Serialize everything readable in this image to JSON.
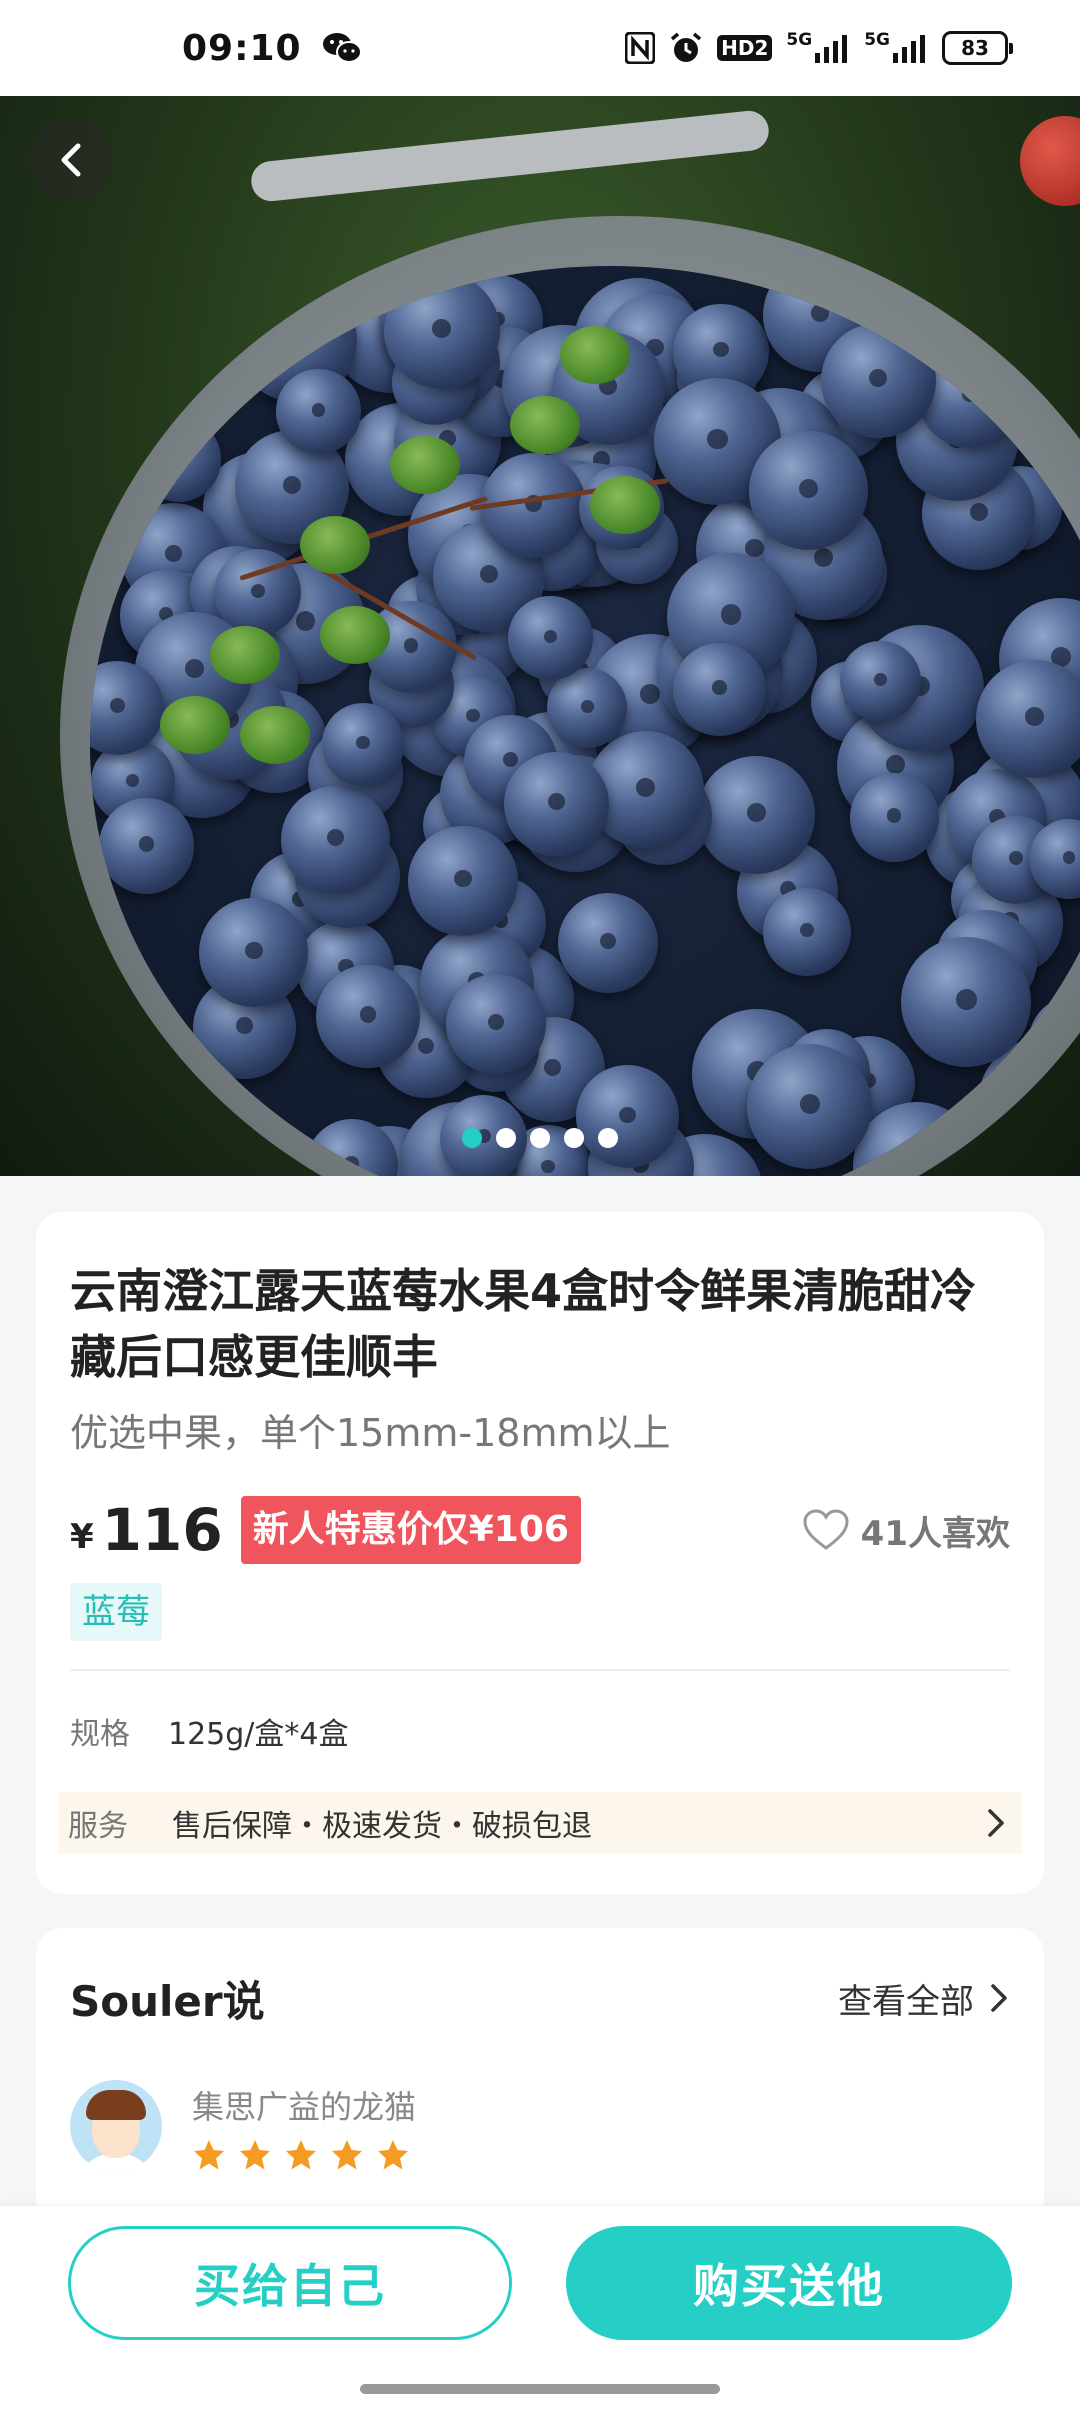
{
  "status_bar": {
    "time": "09:10",
    "icons": [
      "wechat-icon",
      "nfc-icon",
      "alarm-icon",
      "hd-icon",
      "signal-5g-icon",
      "signal-5g-icon"
    ],
    "hd_label": "HD2",
    "network_1": "5G",
    "network_2": "5G",
    "battery": "83"
  },
  "hero": {
    "carousel_total": 5,
    "carousel_active": 1,
    "back_icon": "chevron-left-icon"
  },
  "product": {
    "title": "云南澄江露天蓝莓水果4盒时令鲜果清脆甜冷藏后口感更佳顺丰",
    "subtitle": "优选中果，单个15mm-18mm以上",
    "currency": "¥",
    "price": "116",
    "promo": "新人特惠价仅¥106",
    "likes": "41人喜欢",
    "tag": "蓝莓",
    "spec_label": "规格",
    "spec_value": "125g/盒*4盒",
    "service_label": "服务",
    "service_value": "售后保障・极速发货・破损包退"
  },
  "reviews": {
    "title": "Souler说",
    "see_all": "查看全部",
    "reviewer_name": "集思广益的龙猫",
    "rating": 5
  },
  "actions": {
    "buy_self": "买给自己",
    "buy_gift": "购买送他"
  },
  "colors": {
    "accent": "#25cfc6",
    "promo_red": "#f0545c",
    "star": "#f59a23",
    "service_bg": "#fdf6ec"
  }
}
